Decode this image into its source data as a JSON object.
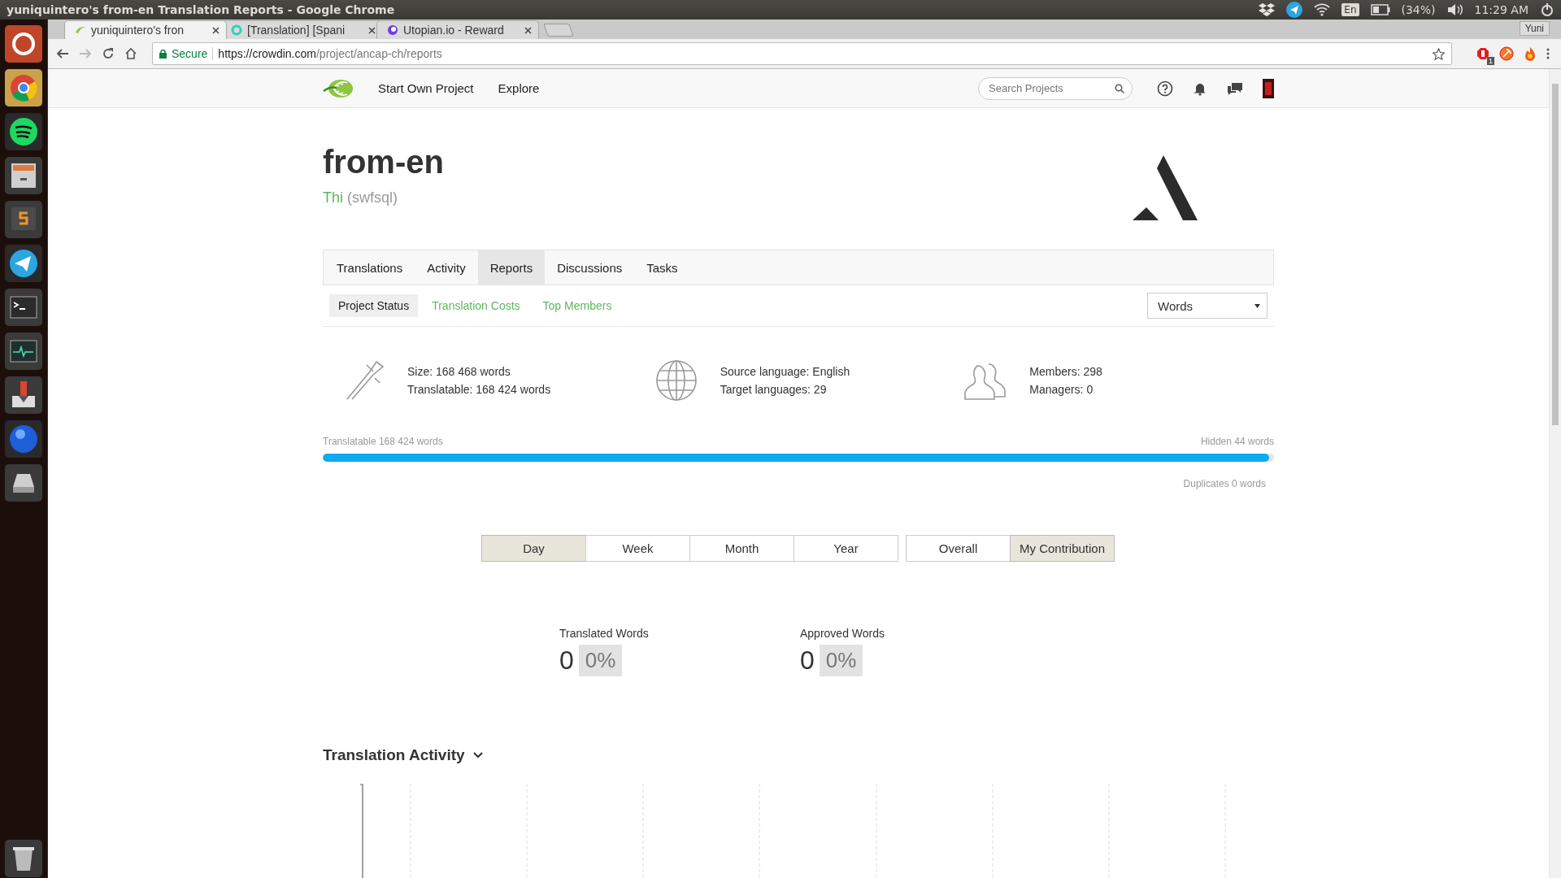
{
  "os_bar": {
    "title": "yuniquintero's from-en Translation Reports - Google Chrome",
    "keyboard": "En",
    "battery": "(34%)",
    "time": "11:29 AM"
  },
  "browser": {
    "tabs": [
      {
        "title": "yuniquintero's fron",
        "selected": true
      },
      {
        "title": "[Translation] [Spani",
        "selected": false
      },
      {
        "title": "Utopian.io - Reward",
        "selected": false
      }
    ],
    "profile": "Yuni",
    "secure": "Secure",
    "url_host": "https://crowdin.com",
    "url_path": "/project/ancap-ch/reports",
    "extension_badge": "1"
  },
  "header": {
    "nav": [
      "Start Own Project",
      "Explore"
    ],
    "search": {
      "placeholder": "Search Projects"
    }
  },
  "project": {
    "title": "from-en",
    "owner": "Thi",
    "handle": "(swfsql)"
  },
  "tabs": [
    {
      "label": "Translations",
      "selected": false
    },
    {
      "label": "Activity",
      "selected": false
    },
    {
      "label": "Reports",
      "selected": true
    },
    {
      "label": "Discussions",
      "selected": false
    },
    {
      "label": "Tasks",
      "selected": false
    }
  ],
  "subtabs": [
    {
      "label": "Project Status",
      "selected": true
    },
    {
      "label": "Translation Costs",
      "selected": false
    },
    {
      "label": "Top Members",
      "selected": false
    }
  ],
  "unit_select": {
    "value": "Words"
  },
  "stats": [
    {
      "kind": "size",
      "lines": [
        "Size: 168 468 words",
        "Translatable: 168 424 words"
      ]
    },
    {
      "kind": "language",
      "lines": [
        "Source language: English",
        "Target languages: 29"
      ]
    },
    {
      "kind": "members",
      "lines": [
        "Members: 298",
        "Managers: 0"
      ]
    }
  ],
  "progress": {
    "left_label": "Translatable 168 424 words",
    "right_label": "Hidden 44 words",
    "level": 0.995,
    "duplicates": "Duplicates 0 words"
  },
  "periods": [
    [
      {
        "label": "Day",
        "selected": true
      },
      {
        "label": "Week",
        "selected": false
      },
      {
        "label": "Month",
        "selected": false
      },
      {
        "label": "Year",
        "selected": false
      }
    ],
    [
      {
        "label": "Overall",
        "selected": false
      },
      {
        "label": "My Contribution",
        "selected": true
      }
    ]
  ],
  "metrics": [
    {
      "label": "Translated Words",
      "value": "0",
      "percent": "0%"
    },
    {
      "label": "Approved Words",
      "value": "0",
      "percent": "0%"
    }
  ],
  "activity": {
    "title": "Translation Activity"
  }
}
